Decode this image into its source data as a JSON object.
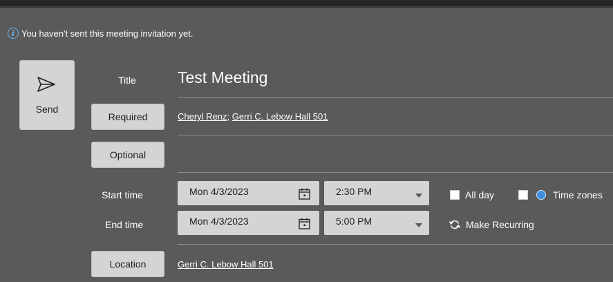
{
  "info": {
    "message": "You haven't sent this meeting invitation yet."
  },
  "send": {
    "label": "Send"
  },
  "title": {
    "label": "Title",
    "value": "Test Meeting"
  },
  "required": {
    "label": "Required",
    "attendees": [
      "Cheryl Renz",
      "Gerri C. Lebow Hall 501"
    ],
    "separator": "; "
  },
  "optional": {
    "label": "Optional"
  },
  "start": {
    "label": "Start time",
    "date": "Mon 4/3/2023",
    "time": "2:30 PM"
  },
  "end": {
    "label": "End time",
    "date": "Mon 4/3/2023",
    "time": "5:00 PM"
  },
  "options": {
    "all_day": "All day",
    "all_day_checked": false,
    "time_zones": "Time zones",
    "time_zones_checked": false,
    "make_recurring": "Make Recurring"
  },
  "location": {
    "label": "Location",
    "value": "Gerri C. Lebow Hall 501"
  },
  "colors": {
    "background": "#5a5a5a",
    "button": "#d4d4d4",
    "info_accent": "#6ab0f0"
  }
}
